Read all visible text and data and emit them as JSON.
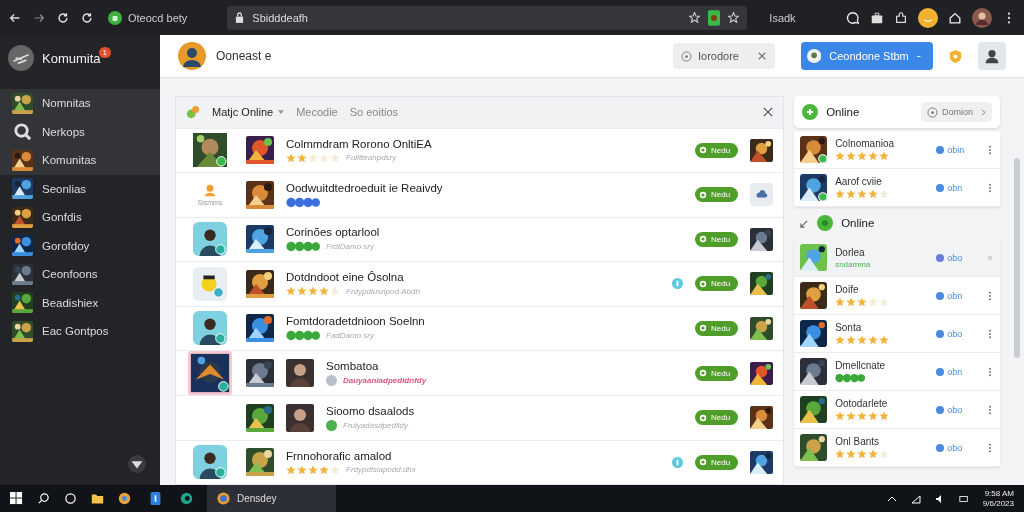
{
  "browser": {
    "tab_title": "Oteocd bety",
    "address": "Sbidddeafh",
    "toolbar_label": "Isadk"
  },
  "sidebar": {
    "title": "Komumita",
    "badge": "1",
    "items": [
      {
        "label": "Nomnitas",
        "kind": "picture",
        "selected": true
      },
      {
        "label": "Nerkops",
        "kind": "icon",
        "selected": true
      },
      {
        "label": "Komunitas",
        "kind": "picture",
        "selected": true
      },
      {
        "label": "Seonlias",
        "kind": "picture",
        "selected": false
      },
      {
        "label": "Gonfdis",
        "kind": "picture",
        "selected": false
      },
      {
        "label": "Gorofdoy",
        "kind": "picture",
        "selected": false
      },
      {
        "label": "Ceonfoons",
        "kind": "picture",
        "selected": false
      },
      {
        "label": "Beadishiex",
        "kind": "picture",
        "selected": false
      },
      {
        "label": "Eac Gontpos",
        "kind": "picture",
        "selected": false
      }
    ]
  },
  "header": {
    "user_name": "Ooneast e",
    "filter_chip": "Iorodore",
    "account_button": "Ceondone Stbm"
  },
  "panel": {
    "tabs": [
      {
        "label": "Matjc Online",
        "selected": true
      },
      {
        "label": "Mecodie",
        "selected": false
      },
      {
        "label": "So eoitios",
        "selected": false
      }
    ],
    "rows": [
      {
        "portrait": false,
        "title": "Colmmdram Rorono OnltiEA",
        "rating": {
          "kind": "stars",
          "stars": 2
        },
        "subtitle": "Fuiltteanpdsry",
        "warning": false,
        "notice": false,
        "action": "Nedu"
      },
      {
        "left": {
          "kind": "icon",
          "label": "Sismms"
        },
        "portrait": false,
        "title": "Oodwuitdtedroeduit ie Reaivdy",
        "rating": {
          "kind": "badges",
          "color": "#3b6fe0"
        },
        "notice": false,
        "action": "Nedu",
        "right": {
          "kind": "icon"
        }
      },
      {
        "left": {
          "kind": "avatar"
        },
        "portrait": false,
        "title": "Corinões optarlool",
        "rating": {
          "kind": "badges",
          "color": "#3aa83a"
        },
        "subtitle": "FrdlDamo sry",
        "warning": false,
        "notice": false,
        "action": "Nedu"
      },
      {
        "left": {
          "kind": "mascot"
        },
        "portrait": false,
        "title": "Dotdndoot eine Ôsolna",
        "rating": {
          "kind": "stars",
          "stars": 4
        },
        "subtitle": "Frdypdlusnpod.Abdh",
        "warning": false,
        "notice": true,
        "action": "Nedu"
      },
      {
        "left": {
          "kind": "avatar"
        },
        "portrait": false,
        "title": "Fomtdoradetdnioon Soelnn",
        "rating": {
          "kind": "badges",
          "color": "#3aa83a"
        },
        "subtitle": "FadDamo sry",
        "warning": false,
        "notice": false,
        "action": "Nedu"
      },
      {
        "left": {
          "kind": "featured"
        },
        "portrait": true,
        "title": "Sombatoa",
        "rating": {
          "kind": "dot",
          "color": "#b9c0cc"
        },
        "subtitle": "Dauyaaniadpedidnfdy",
        "warning": true,
        "notice": false,
        "action": "Nedu"
      },
      {
        "left": {
          "kind": "none"
        },
        "portrait": true,
        "title": "Sioomo dsaalods",
        "rating": {
          "kind": "dot",
          "color": "#4caf50"
        },
        "subtitle": "Fruiyadasdpediidy",
        "warning": false,
        "notice": false,
        "action": "Nedu"
      },
      {
        "left": {
          "kind": "avatar"
        },
        "portrait": false,
        "title": "Frnnohorafic amalod",
        "rating": {
          "kind": "stars",
          "stars": 4
        },
        "subtitle": "Frdypdlsiapodd.dhx",
        "warning": false,
        "notice": true,
        "action": "Nedu"
      }
    ]
  },
  "online_card": {
    "title": "Online",
    "chip": "Domion",
    "items": [
      {
        "name": "Colnomanioa",
        "rating": {
          "kind": "stars",
          "stars": 5
        },
        "status": "obin",
        "selected": false
      },
      {
        "name": "Aarof cviie",
        "rating": {
          "kind": "stars",
          "stars": 4
        },
        "status": "obn",
        "selected": false
      }
    ]
  },
  "online_section": {
    "title": "Online",
    "items": [
      {
        "name": "Dorlea",
        "rating": {
          "kind": "text",
          "text": "sndamma"
        },
        "status": "obo",
        "selected": true
      },
      {
        "name": "Doife",
        "rating": {
          "kind": "stars",
          "stars": 3
        },
        "status": "obn",
        "selected": false
      },
      {
        "name": "Sonta",
        "rating": {
          "kind": "stars",
          "stars": 5
        },
        "status": "obo",
        "selected": false
      },
      {
        "name": "Dmellcnate",
        "rating": {
          "kind": "badges",
          "color": "#3aa83a"
        },
        "status": "obn",
        "selected": false
      },
      {
        "name": "Ootodarlete",
        "rating": {
          "kind": "stars",
          "stars": 5
        },
        "status": "obo",
        "selected": false
      },
      {
        "name": "Onl Bants",
        "rating": {
          "kind": "stars",
          "stars": 4
        },
        "status": "obo",
        "selected": false
      }
    ]
  },
  "taskbar": {
    "app_label": "Densdey",
    "time": "9:58 AM",
    "date": "9/6/2023"
  }
}
